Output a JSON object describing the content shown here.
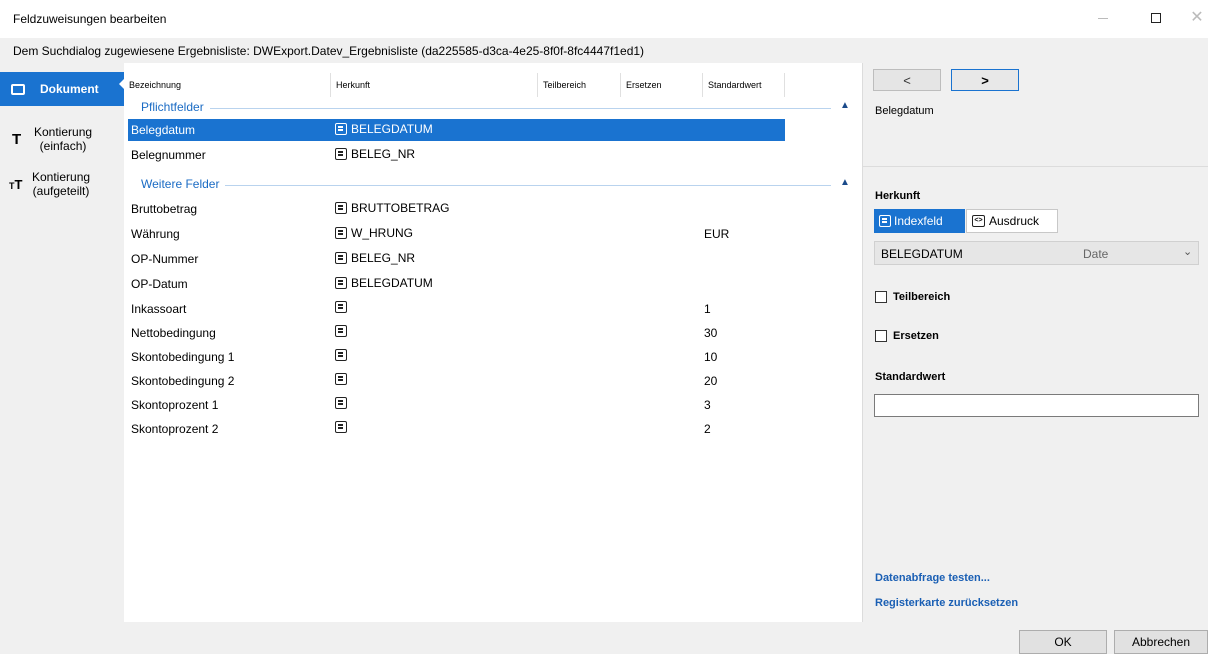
{
  "window": {
    "title": "Feldzuweisungen bearbeiten",
    "controls": {
      "minimize_icon": "minimize-icon",
      "maximize_icon": "maximize-icon",
      "close_icon": "close-icon"
    }
  },
  "info": {
    "text": "Dem Suchdialog zugewiesene Ergebnisliste: DWExport.Datev_Ergebnisliste (da225585-d3ca-4e25-8f0f-8fc4447f1ed1)"
  },
  "leftnav": {
    "items": [
      {
        "label": "Dokument",
        "icon": "document-icon",
        "active": true
      },
      {
        "label": "Kontierung\n(einfach)",
        "line1": "Kontierung",
        "line2": "(einfach)",
        "icon": "T",
        "active": false
      },
      {
        "label": "Kontierung\n(aufgeteilt)",
        "line1": "Kontierung",
        "line2": "(aufgeteilt)",
        "icon": "TT",
        "active": false
      }
    ]
  },
  "table": {
    "columns": [
      "Bezeichnung",
      "Herkunft",
      "Teilbereich",
      "Ersetzen",
      "Standardwert"
    ],
    "groups": [
      {
        "label": "Pflichtfelder",
        "rows": [
          {
            "name": "Belegdatum",
            "source": "BELEGDATUM",
            "default": "",
            "selected": true
          },
          {
            "name": "Belegnummer",
            "source": "BELEG_NR",
            "default": ""
          }
        ]
      },
      {
        "label": "Weitere Felder",
        "rows": [
          {
            "name": "Bruttobetrag",
            "source": "BRUTTOBETRAG",
            "default": ""
          },
          {
            "name": "Währung",
            "source": "W_HRUNG",
            "default": "EUR"
          },
          {
            "name": "OP-Nummer",
            "source": "BELEG_NR",
            "default": ""
          },
          {
            "name": "OP-Datum",
            "source": "BELEGDATUM",
            "default": ""
          },
          {
            "name": "Inkassoart",
            "source": "",
            "default": "1"
          },
          {
            "name": "Nettobedingung",
            "source": "",
            "default": "30"
          },
          {
            "name": "Skontobedingung 1",
            "source": "",
            "default": "10"
          },
          {
            "name": "Skontobedingung 2",
            "source": "",
            "default": "20"
          },
          {
            "name": "Skontoprozent 1",
            "source": "",
            "default": "3"
          },
          {
            "name": "Skontoprozent 2",
            "source": "",
            "default": "2"
          }
        ]
      }
    ],
    "collapse_glyph": "▲"
  },
  "rightpanel": {
    "prev_glyph": "<",
    "next_glyph": ">",
    "field_name": "Belegdatum",
    "herkunft_label": "Herkunft",
    "toggle_index": "Indexfeld",
    "toggle_expr": "Ausdruck",
    "dropdown_value": "BELEGDATUM",
    "dropdown_type": "Date",
    "dropdown_chevron": "⌄",
    "teilbereich_label": "Teilbereich",
    "ersetzen_label": "Ersetzen",
    "standardwert_label": "Standardwert",
    "standardwert_value": "",
    "link_test": "Datenabfrage testen...",
    "link_reset": "Registerkarte zurücksetzen"
  },
  "footer": {
    "ok_label": "OK",
    "cancel_label": "Abbrechen"
  },
  "colors": {
    "accent": "#1a73d0",
    "group_label": "#1a6bc4",
    "link": "#1a5fb4",
    "panel_bg": "#f0f0f0"
  }
}
